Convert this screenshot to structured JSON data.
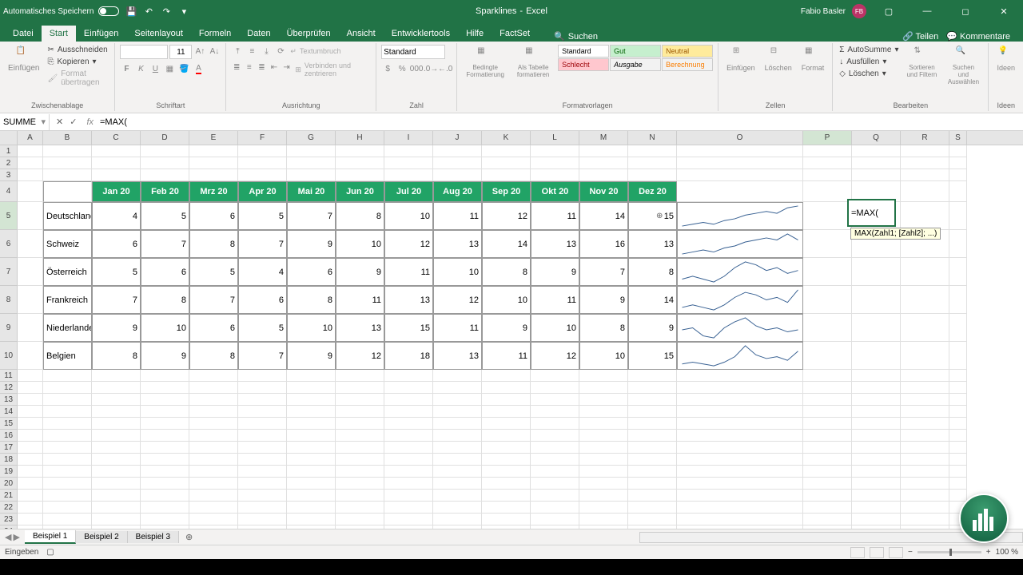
{
  "titlebar": {
    "autosave": "Automatisches Speichern",
    "doc_name": "Sparklines",
    "app_name": "Excel",
    "user_name": "Fabio Basler",
    "user_initials": "FB"
  },
  "tabs": {
    "datei": "Datei",
    "start": "Start",
    "einfuegen": "Einfügen",
    "seitenlayout": "Seitenlayout",
    "formeln": "Formeln",
    "daten": "Daten",
    "ueberpruefen": "Überprüfen",
    "ansicht": "Ansicht",
    "entwicklertools": "Entwicklertools",
    "hilfe": "Hilfe",
    "factset": "FactSet",
    "suchen": "Suchen",
    "teilen": "Teilen",
    "kommentare": "Kommentare"
  },
  "ribbon": {
    "einfuegen": "Einfügen",
    "ausschneiden": "Ausschneiden",
    "kopieren": "Kopieren",
    "format_uebertragen": "Format übertragen",
    "zwischenablage": "Zwischenablage",
    "schriftart": "Schriftart",
    "font_size": "11",
    "ausrichtung": "Ausrichtung",
    "textumbruch": "Textumbruch",
    "verbinden": "Verbinden und zentrieren",
    "zahl": "Zahl",
    "zahl_format": "Standard",
    "bedingte": "Bedingte Formatierung",
    "als_tabelle": "Als Tabelle formatieren",
    "formatvorlagen": "Formatvorlagen",
    "style_standard": "Standard",
    "style_gut": "Gut",
    "style_neutral": "Neutral",
    "style_schlecht": "Schlecht",
    "style_ausgabe": "Ausgabe",
    "style_berechnung": "Berechnung",
    "zellen": "Zellen",
    "zellen_einfuegen": "Einfügen",
    "zellen_loeschen": "Löschen",
    "zellen_format": "Format",
    "bearbeiten": "Bearbeiten",
    "autosumme": "AutoSumme",
    "ausfuellen": "Ausfüllen",
    "loeschen": "Löschen",
    "sortieren": "Sortieren und Filtern",
    "suchen_auswaehlen": "Suchen und Auswählen",
    "ideen": "Ideen"
  },
  "formula_bar": {
    "name_box": "SUMME",
    "formula": "=MAX("
  },
  "columns": [
    "A",
    "B",
    "C",
    "D",
    "E",
    "F",
    "G",
    "H",
    "I",
    "J",
    "K",
    "L",
    "M",
    "N",
    "O",
    "P",
    "Q",
    "R",
    "S"
  ],
  "chart_data": {
    "type": "table",
    "headers": [
      "Jan 20",
      "Feb 20",
      "Mrz 20",
      "Apr 20",
      "Mai 20",
      "Jun 20",
      "Jul 20",
      "Aug 20",
      "Sep 20",
      "Okt 20",
      "Nov 20",
      "Dez 20"
    ],
    "rows": [
      {
        "label": "Deutschland",
        "values": [
          4,
          5,
          6,
          5,
          7,
          8,
          10,
          11,
          12,
          11,
          14,
          15
        ]
      },
      {
        "label": "Schweiz",
        "values": [
          6,
          7,
          8,
          7,
          9,
          10,
          12,
          13,
          14,
          13,
          16,
          13
        ]
      },
      {
        "label": "Österreich",
        "values": [
          5,
          6,
          5,
          4,
          6,
          9,
          11,
          10,
          8,
          9,
          7,
          8
        ]
      },
      {
        "label": "Frankreich",
        "values": [
          7,
          8,
          7,
          6,
          8,
          11,
          13,
          12,
          10,
          11,
          9,
          14
        ]
      },
      {
        "label": "Niederlande",
        "values": [
          9,
          10,
          6,
          5,
          10,
          13,
          15,
          11,
          9,
          10,
          8,
          9
        ]
      },
      {
        "label": "Belgien",
        "values": [
          8,
          9,
          8,
          7,
          9,
          12,
          18,
          13,
          11,
          12,
          10,
          15
        ]
      }
    ]
  },
  "active_cell": {
    "text": "=MAX(",
    "tooltip": "MAX(Zahl1; [Zahl2]; ...)"
  },
  "sheets": {
    "s1": "Beispiel 1",
    "s2": "Beispiel 2",
    "s3": "Beispiel 3"
  },
  "status": {
    "mode": "Eingeben",
    "zoom": "100 %"
  }
}
